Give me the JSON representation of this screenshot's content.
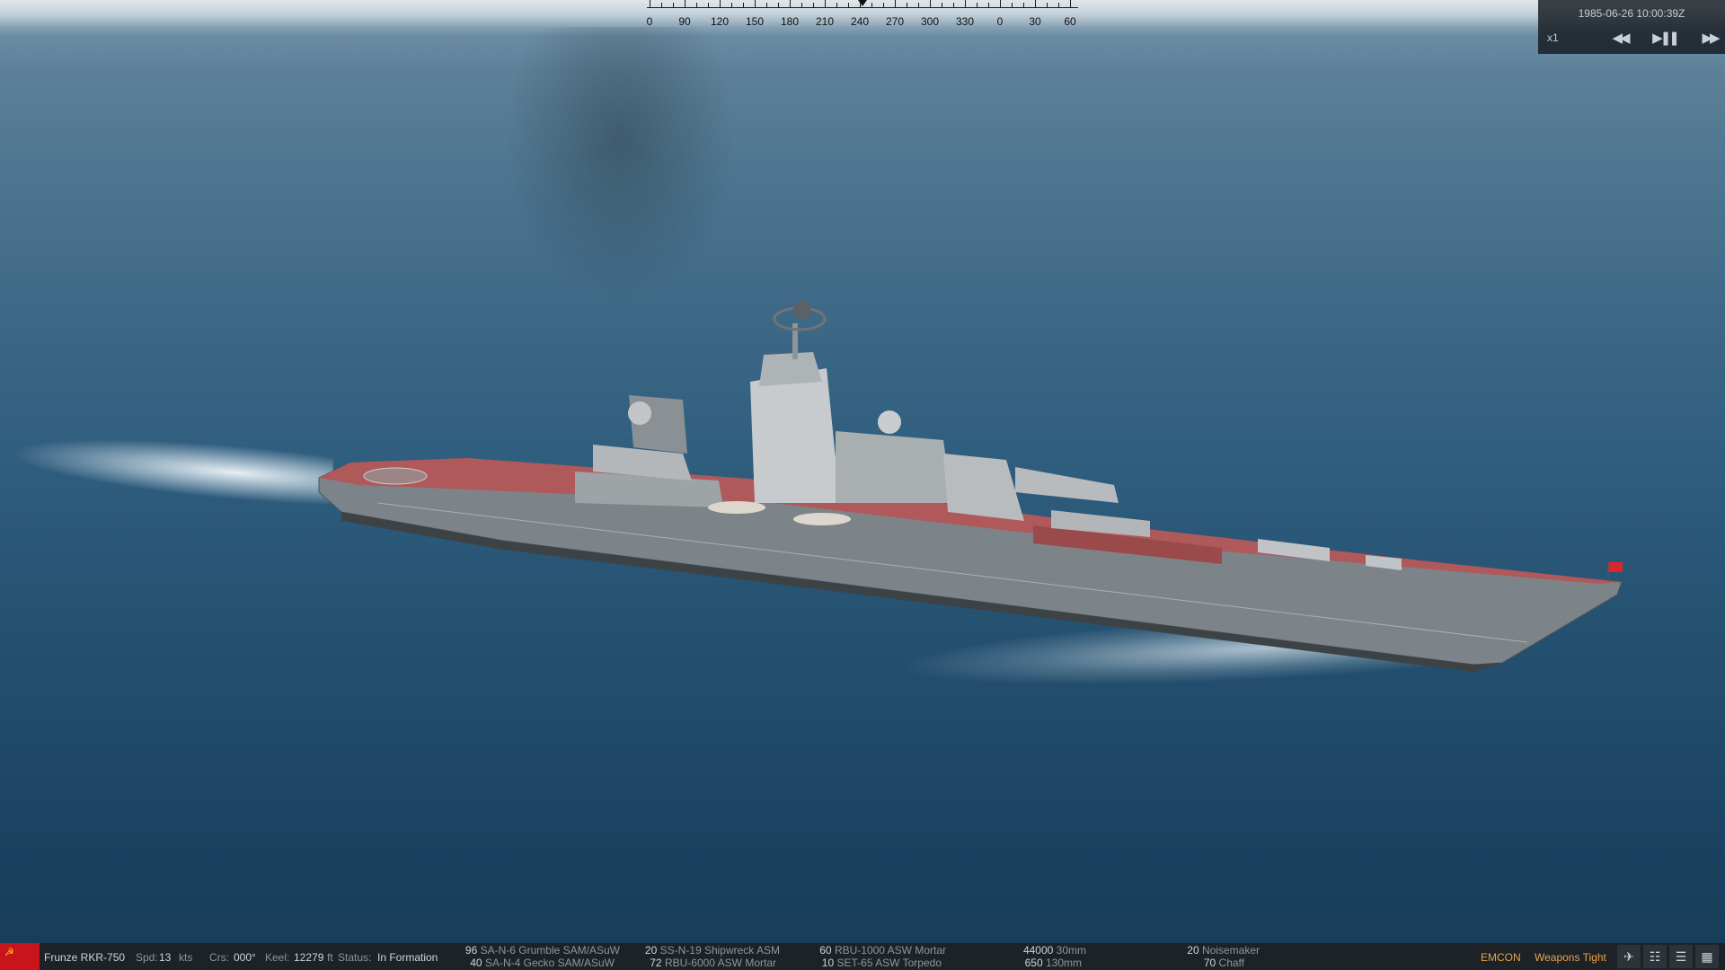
{
  "compass": {
    "labels": [
      "0",
      "90",
      "120",
      "150",
      "180",
      "210",
      "240",
      "270",
      "300",
      "330",
      "0",
      "30",
      "60"
    ]
  },
  "time_control": {
    "datetime": "1985-06-26 10:00:39Z",
    "speed": "x1",
    "icons": [
      "rewind-icon",
      "play-pause-icon",
      "fast-forward-icon"
    ]
  },
  "unit_bar": {
    "flag_icon": "hammer-sickle-icon",
    "unit_name": "Frunze RKR-750",
    "speed_label": "Spd:",
    "speed_value": "13",
    "speed_unit": "kts",
    "course_label": "Crs:",
    "course_value": "000°",
    "keel_label": "Keel:",
    "keel_value": "12279",
    "keel_unit": "ft",
    "status_label": "Status:",
    "status_value": "In Formation",
    "weapons": [
      {
        "count": "96",
        "name": "SA-N-6 Grumble SAM/ASuW"
      },
      {
        "count": "40",
        "name": "SA-N-4 Gecko SAM/ASuW"
      },
      {
        "count": "20",
        "name": "SS-N-19 Shipwreck ASM"
      },
      {
        "count": "72",
        "name": "RBU-6000 ASW Mortar"
      },
      {
        "count": "60",
        "name": "RBU-1000 ASW Mortar"
      },
      {
        "count": "10",
        "name": "SET-65 ASW Torpedo"
      },
      {
        "count": "44000",
        "name": "30mm"
      },
      {
        "count": "650",
        "name": "130mm"
      },
      {
        "count": "20",
        "name": "Noisemaker"
      },
      {
        "count": "70",
        "name": "Chaff"
      }
    ],
    "emcon": "EMCON",
    "weapons_state": "Weapons Tight",
    "view_icons": [
      "aircraft-icon",
      "formation-icon",
      "list-icon",
      "grid-icon"
    ]
  },
  "colors": {
    "accent_orange": "#e6a54a",
    "flag_red": "#c8141a",
    "bar_bg": "#1d2227"
  }
}
